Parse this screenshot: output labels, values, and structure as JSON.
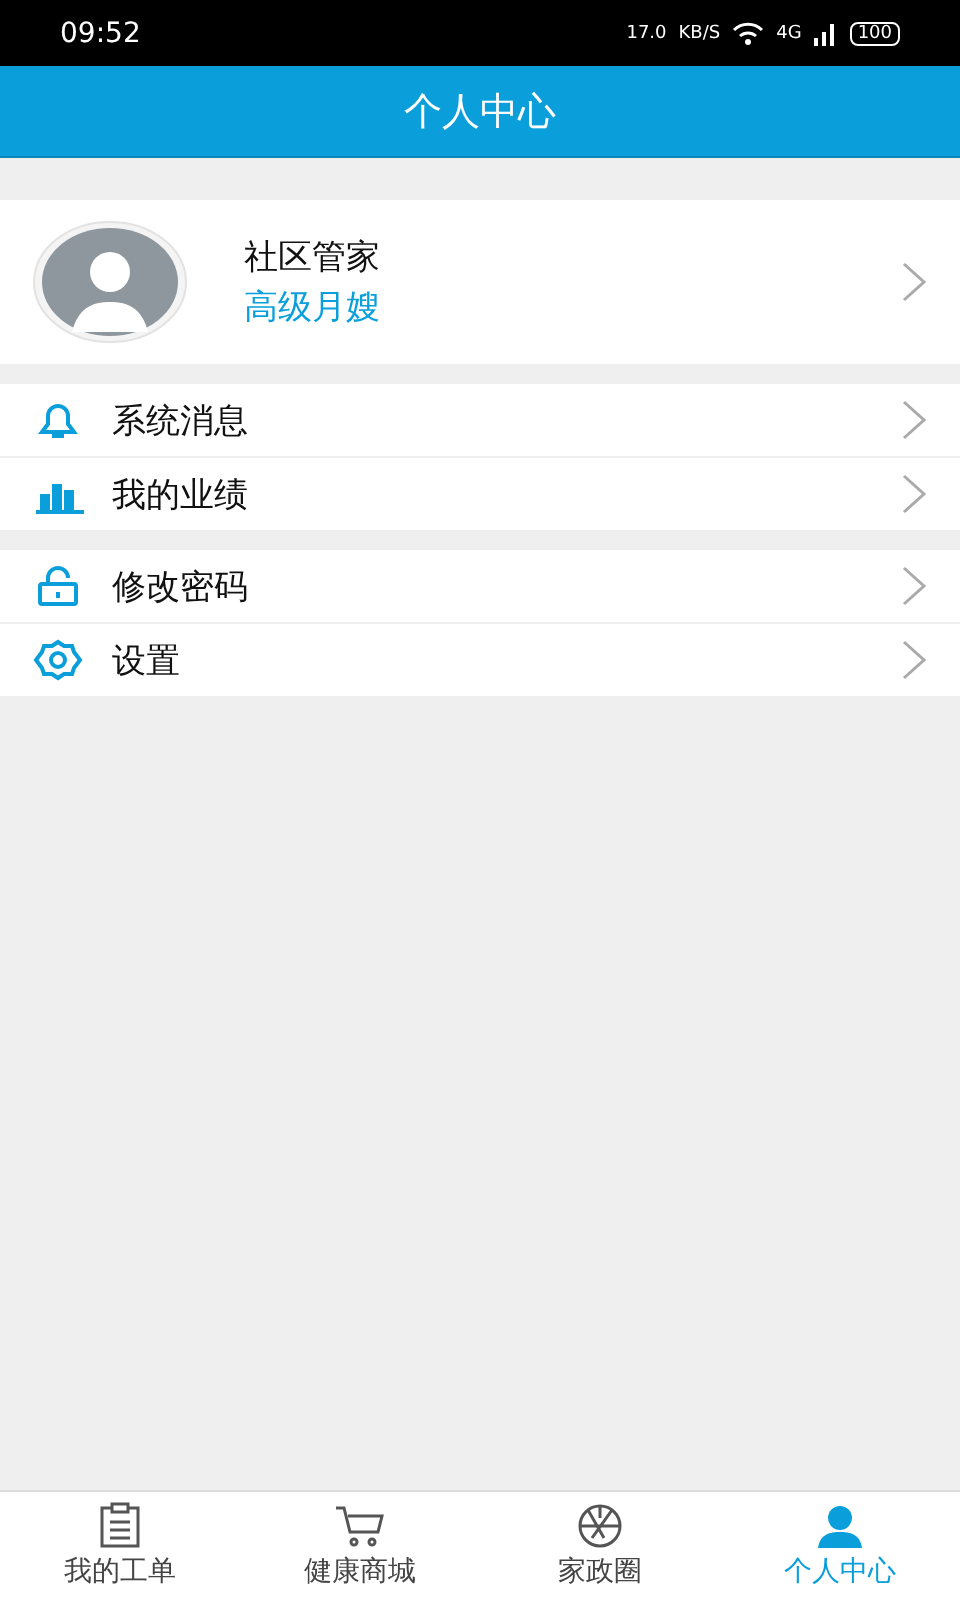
{
  "status_bar": {
    "time": "09:52",
    "speed": "17.0",
    "speed_unit": "KB/S",
    "network": "4G",
    "battery": "100"
  },
  "header": {
    "title": "个人中心"
  },
  "profile": {
    "name": "社区管家",
    "role": "高级月嫂"
  },
  "menu_groups": [
    {
      "items": [
        {
          "kind": "bell",
          "label": "系统消息"
        },
        {
          "kind": "chart",
          "label": "我的业绩"
        }
      ]
    },
    {
      "items": [
        {
          "kind": "lock",
          "label": "修改密码"
        },
        {
          "kind": "gear",
          "label": "设置"
        }
      ]
    }
  ],
  "tabs": [
    {
      "kind": "clipboard",
      "label": "我的工单",
      "selected": false
    },
    {
      "kind": "cart",
      "label": "健康商城",
      "selected": false
    },
    {
      "kind": "aperture",
      "label": "家政圈",
      "selected": false
    },
    {
      "kind": "person",
      "label": "个人中心",
      "selected": true
    }
  ]
}
